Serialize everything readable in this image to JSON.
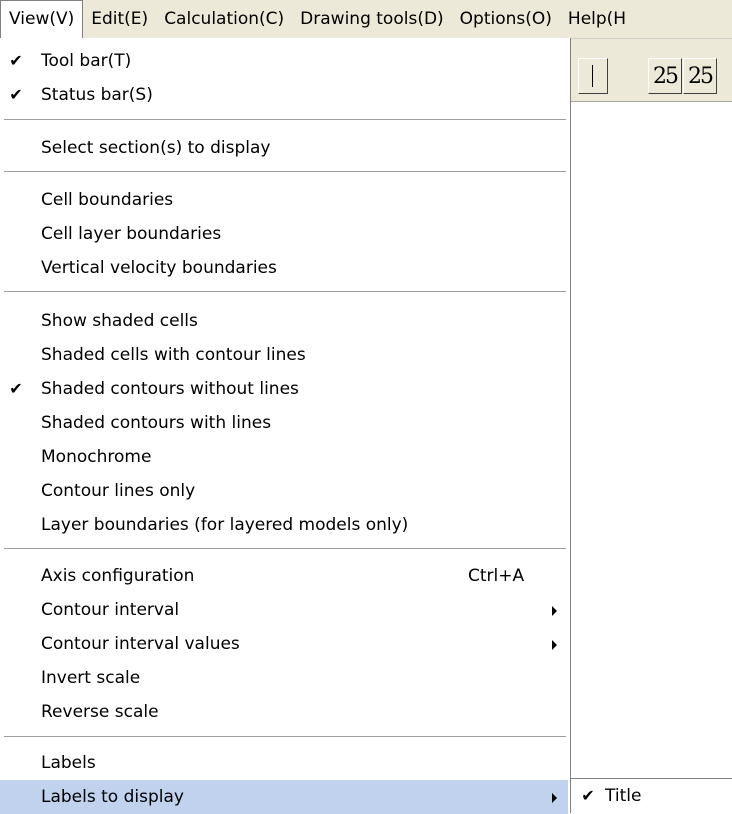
{
  "menubar": {
    "items": [
      {
        "label": "View(V)"
      },
      {
        "label": "Edit(E)"
      },
      {
        "label": "Calculation(C)"
      },
      {
        "label": "Drawing tools(D)"
      },
      {
        "label": "Options(O)"
      },
      {
        "label": "Help(H"
      }
    ]
  },
  "toolbar": {
    "btn1": "25",
    "btn2": "25"
  },
  "view_menu": {
    "check_glyph": "✔",
    "items": [
      {
        "label": "Tool bar(T)",
        "checked": true
      },
      {
        "label": "Status bar(S)",
        "checked": true
      },
      {
        "label": "Select section(s) to display"
      },
      {
        "label": "Cell boundaries"
      },
      {
        "label": "Cell layer boundaries"
      },
      {
        "label": "Vertical velocity boundaries"
      },
      {
        "label": "Show shaded cells"
      },
      {
        "label": "Shaded cells with contour lines"
      },
      {
        "label": "Shaded contours without lines",
        "checked": true
      },
      {
        "label": "Shaded contours with lines"
      },
      {
        "label": "Monochrome"
      },
      {
        "label": "Contour lines only"
      },
      {
        "label": "Layer boundaries (for layered models only)"
      },
      {
        "label": "Axis configuration",
        "shortcut": "Ctrl+A"
      },
      {
        "label": "Contour interval",
        "submenu": true
      },
      {
        "label": "Contour interval values",
        "submenu": true
      },
      {
        "label": "Invert scale"
      },
      {
        "label": "Reverse scale"
      },
      {
        "label": "Labels"
      },
      {
        "label": "Labels to display",
        "submenu": true,
        "highlighted": true
      }
    ]
  },
  "labels_submenu": {
    "items": [
      {
        "label": "Title",
        "checked": true
      }
    ]
  },
  "colors": {
    "menubar_bg": "#ece9d8",
    "highlight": "#c1d2ee"
  }
}
